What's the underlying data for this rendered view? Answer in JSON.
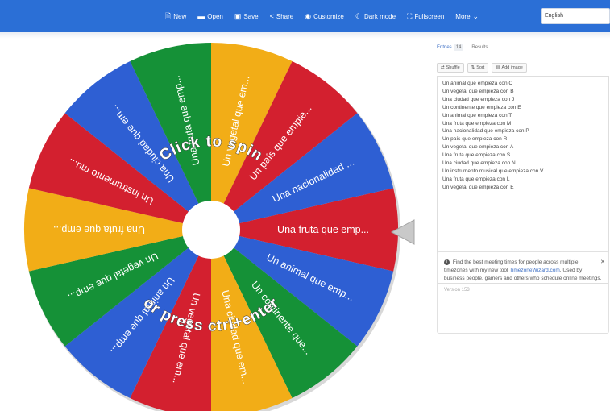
{
  "nav": {
    "items": [
      {
        "icon": "new-icon",
        "glyph": "🗎",
        "label": "New"
      },
      {
        "icon": "open-icon",
        "glyph": "▬",
        "label": "Open"
      },
      {
        "icon": "save-icon",
        "glyph": "▣",
        "label": "Save"
      },
      {
        "icon": "share-icon",
        "glyph": "<",
        "label": "Share"
      },
      {
        "icon": "palette-icon",
        "glyph": "◉",
        "label": "Customize"
      },
      {
        "icon": "moon-icon",
        "glyph": "☾",
        "label": "Dark mode"
      },
      {
        "icon": "fullscreen-icon",
        "glyph": "⛶",
        "label": "Fullscreen"
      },
      {
        "icon": "chevron-down-icon",
        "glyph": "⌄",
        "label": "More"
      }
    ],
    "language": "English"
  },
  "wheel": {
    "colors": [
      "#d3202f",
      "#2e5fd3",
      "#159137",
      "#f2ad17"
    ],
    "segments": [
      "Una fruta que emp...",
      "Un animal que emp...",
      "Un continente que...",
      "Una ciudad que em...",
      "Un vegetal que em...",
      "Un animal que emp...",
      "Un vegetal que emp...",
      "Una fruta que emp...",
      "Un instrumento mu...",
      "Una ciudad que em...",
      "Una fruta que emp...",
      "Un vegetal que em...",
      "Un país que empie...",
      "Una nacionalidad ..."
    ],
    "cta_top": "Click to spin",
    "cta_bottom": "or press ctrl+enter"
  },
  "sidebar": {
    "tabs": [
      {
        "label": "Entries",
        "count": "14"
      },
      {
        "label": "Results"
      }
    ],
    "toolbar": [
      {
        "icon": "shuffle-icon",
        "glyph": "⇄",
        "label": "Shuffle"
      },
      {
        "icon": "sort-icon",
        "glyph": "⇅",
        "label": "Sort"
      },
      {
        "icon": "image-icon",
        "glyph": "▨",
        "label": "Add image"
      }
    ],
    "entries": [
      "Un animal que empieza con C",
      "Un vegetal que empieza con B",
      "Una ciudad que empieza con J",
      "Un continente que empieza con E",
      "Un animal que empieza con T",
      "Una fruta que empieza con M",
      "Una nacionalidad que empieza con P",
      "Un país que empieza con R",
      "Un vegetal que empieza con A",
      "Una fruta que empieza con S",
      "Una ciudad que empieza con N",
      "Un instrumento musical que empieza con V",
      "Una fruta que empieza con L",
      "Un vegetal que empieza con E"
    ],
    "note": {
      "text_before": "Find the best meeting times for people across multiple timezones with my new tool",
      "link": "TimezoneWizard.com",
      "text_after": ". Used by business people, gamers and others who schedule online meetings.",
      "close": "✕",
      "version": "Version 153"
    }
  }
}
